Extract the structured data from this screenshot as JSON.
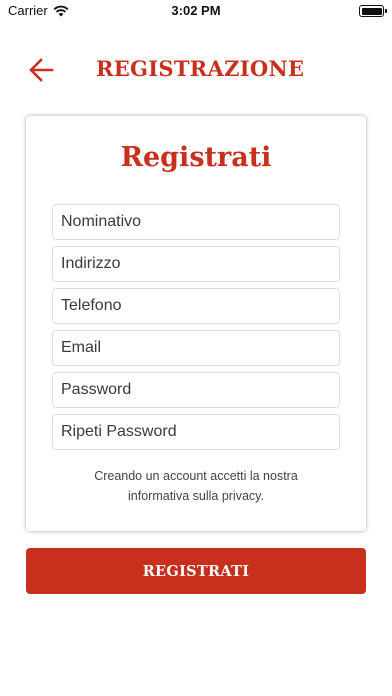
{
  "status_bar": {
    "carrier": "Carrier",
    "time": "3:02 PM"
  },
  "header": {
    "title": "REGISTRAZIONE"
  },
  "form": {
    "title": "Registrati",
    "fields": {
      "nominativo": {
        "placeholder": "Nominativo",
        "value": ""
      },
      "indirizzo": {
        "placeholder": "Indirizzo",
        "value": ""
      },
      "telefono": {
        "placeholder": "Telefono",
        "value": ""
      },
      "email": {
        "placeholder": "Email",
        "value": ""
      },
      "password": {
        "placeholder": "Password",
        "value": ""
      },
      "repeat_password": {
        "placeholder": "Ripeti Password",
        "value": ""
      }
    },
    "privacy_line1": "Creando un account accetti la nostra",
    "privacy_line2": "informativa sulla privacy.",
    "submit_label": "REGISTRATI"
  },
  "colors": {
    "accent": "#c8301d"
  },
  "icons": {
    "back": "arrow-left-icon",
    "wifi": "wifi-icon",
    "battery": "battery-icon"
  }
}
